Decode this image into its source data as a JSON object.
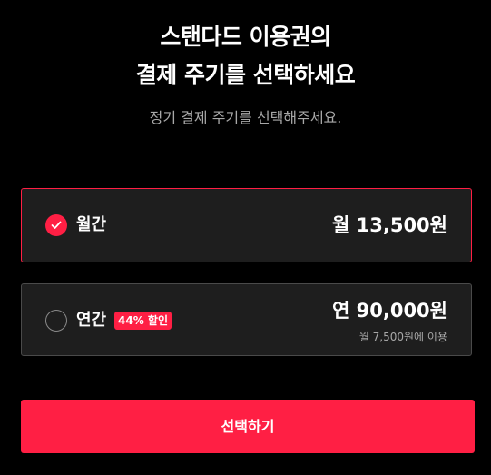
{
  "header": {
    "title_line1": "스탠다드 이용권의",
    "title_line2": "결제 주기를 선택하세요",
    "subtitle": "정기 결제 주기를 선택해주세요."
  },
  "plans": [
    {
      "name": "월간",
      "price": "월 13,500원",
      "selected": true
    },
    {
      "name": "연간",
      "badge": "44% 할인",
      "price": "연 90,000원",
      "note": "월 7,500원에 이용",
      "selected": false
    }
  ],
  "action": {
    "select_label": "선택하기"
  },
  "colors": {
    "accent": "#ff1f44",
    "background": "#000000",
    "card": "#1e1e1e",
    "muted_text": "#a8a8a8"
  }
}
